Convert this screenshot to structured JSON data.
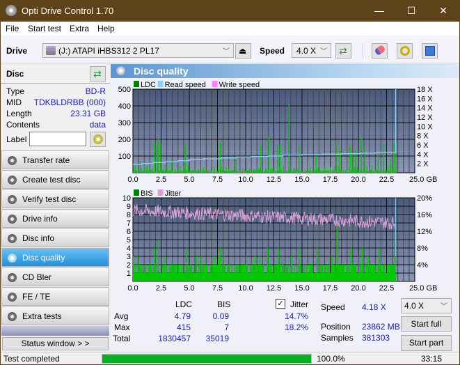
{
  "window": {
    "title": "Opti Drive Control 1.70",
    "controls": {
      "minimize": "—",
      "maximize": "☐",
      "close": "✕"
    }
  },
  "menu": [
    "File",
    "Start test",
    "Extra",
    "Help"
  ],
  "toolbar": {
    "drive_label": "Drive",
    "drive_value": "(J:)  ATAPI iHBS312   2 PL17",
    "speed_label": "Speed",
    "speed_value": "4.0 X"
  },
  "disc": {
    "title": "Disc",
    "rows": [
      {
        "k": "Type",
        "v": "BD-R"
      },
      {
        "k": "MID",
        "v": "TDKBLDRBB (000)"
      },
      {
        "k": "Length",
        "v": "23.31 GB"
      },
      {
        "k": "Contents",
        "v": "data"
      }
    ],
    "label_label": "Label",
    "label_value": ""
  },
  "nav": [
    {
      "label": "Transfer rate"
    },
    {
      "label": "Create test disc"
    },
    {
      "label": "Verify test disc"
    },
    {
      "label": "Drive info"
    },
    {
      "label": "Disc info"
    },
    {
      "label": "Disc quality",
      "active": true
    },
    {
      "label": "CD Bler"
    },
    {
      "label": "FE / TE"
    },
    {
      "label": "Extra tests"
    }
  ],
  "status_window_label": "Status window > >",
  "panel_title": "Disc quality",
  "chart_data": [
    {
      "type": "bar",
      "title": "LDC",
      "legend": [
        "LDC",
        "Read speed",
        "Write speed"
      ],
      "legend_colors": [
        "#008000",
        "#87cefa",
        "#ff80ff"
      ],
      "x_ticks": [
        "0.0",
        "2.5",
        "5.0",
        "7.5",
        "10.0",
        "12.5",
        "15.0",
        "17.5",
        "20.0",
        "22.5",
        "25.0 GB"
      ],
      "xlim": [
        0,
        25
      ],
      "y_ticks": [
        "500",
        "400",
        "300",
        "200",
        "100"
      ],
      "ylim": [
        0,
        500
      ],
      "y2_ticks": [
        "18 X",
        "16 X",
        "14 X",
        "12 X",
        "10 X",
        "8 X",
        "6 X",
        "4 X",
        "2 X"
      ],
      "y2lim": [
        0,
        18
      ],
      "ldc_peaks": [
        [
          0.6,
          70
        ],
        [
          1.9,
          175
        ],
        [
          2.1,
          160
        ],
        [
          2.2,
          215
        ],
        [
          2.4,
          175
        ],
        [
          3.4,
          80
        ],
        [
          4.6,
          165
        ],
        [
          7.7,
          180
        ],
        [
          9.1,
          80
        ],
        [
          11.3,
          165
        ],
        [
          12.0,
          215
        ],
        [
          12.8,
          170
        ],
        [
          13.0,
          170
        ],
        [
          13.8,
          410
        ],
        [
          14.7,
          165
        ],
        [
          16.2,
          100
        ],
        [
          18.0,
          185
        ],
        [
          18.3,
          140
        ],
        [
          19.2,
          160
        ],
        [
          19.4,
          120
        ],
        [
          19.7,
          135
        ],
        [
          20.2,
          210
        ],
        [
          20.5,
          160
        ],
        [
          21.7,
          110
        ],
        [
          22.2,
          175
        ],
        [
          22.8,
          85
        ],
        [
          23.1,
          180
        ],
        [
          23.3,
          120
        ]
      ],
      "read_speed": [
        [
          0,
          1.8
        ],
        [
          0.8,
          2.0
        ],
        [
          1.8,
          2.2
        ],
        [
          2.9,
          2.4
        ],
        [
          4.0,
          2.6
        ],
        [
          5.0,
          2.8
        ],
        [
          6.3,
          3.0
        ],
        [
          7.8,
          3.2
        ],
        [
          9.2,
          3.4
        ],
        [
          10.5,
          3.5
        ],
        [
          12.0,
          3.6
        ],
        [
          13.3,
          3.8
        ],
        [
          15.0,
          3.9
        ],
        [
          16.8,
          4.0
        ],
        [
          18.5,
          4.1
        ],
        [
          20.2,
          4.2
        ],
        [
          21.5,
          4.3
        ],
        [
          23.3,
          4.3
        ],
        [
          23.31,
          18
        ]
      ]
    },
    {
      "type": "bar",
      "title": "BIS / Jitter",
      "legend": [
        "BIS",
        "Jitter"
      ],
      "legend_colors": [
        "#008000",
        "#d8a0d8"
      ],
      "x_ticks": [
        "0.0",
        "2.5",
        "5.0",
        "7.5",
        "10.0",
        "12.5",
        "15.0",
        "17.5",
        "20.0",
        "22.5",
        "25.0 GB"
      ],
      "xlim": [
        0,
        25
      ],
      "y_ticks": [
        "10",
        "9",
        "8",
        "7",
        "6",
        "5",
        "4",
        "3",
        "2",
        "1"
      ],
      "ylim": [
        0,
        10
      ],
      "y2_ticks": [
        "20%",
        "16%",
        "12%",
        "8%",
        "4%"
      ],
      "y2lim": [
        0,
        20
      ],
      "bis_peaks": [
        [
          1.9,
          4
        ],
        [
          2.2,
          5
        ],
        [
          4.7,
          4
        ],
        [
          7.7,
          4
        ],
        [
          11.9,
          4
        ],
        [
          12.9,
          4
        ],
        [
          14.7,
          4
        ],
        [
          16.3,
          4
        ],
        [
          18.1,
          7
        ],
        [
          19.3,
          4
        ],
        [
          20.3,
          4
        ],
        [
          21.8,
          4
        ],
        [
          23.2,
          6
        ]
      ],
      "jitter_avg_start": 17.0,
      "jitter_avg_end": 14.0
    }
  ],
  "stats": {
    "col_ldc": "LDC",
    "col_bis": "BIS",
    "jitter_label": "Jitter",
    "jitter_checked": true,
    "rows": [
      {
        "k": "Avg",
        "ldc": "4.79",
        "bis": "0.09",
        "jit": "14.7%"
      },
      {
        "k": "Max",
        "ldc": "415",
        "bis": "7",
        "jit": "18.2%"
      },
      {
        "k": "Total",
        "ldc": "1830457",
        "bis": "35019",
        "jit": ""
      }
    ],
    "speed_label": "Speed",
    "speed_value": "4.18 X",
    "position_label": "Position",
    "position_value": "23862 MB",
    "samples_label": "Samples",
    "samples_value": "381303",
    "speed_select": "4.0 X",
    "start_full": "Start full",
    "start_part": "Start part"
  },
  "statusbar": {
    "text": "Test completed",
    "progress": 100.0,
    "progress_label": "100.0%",
    "time": "33:15"
  }
}
